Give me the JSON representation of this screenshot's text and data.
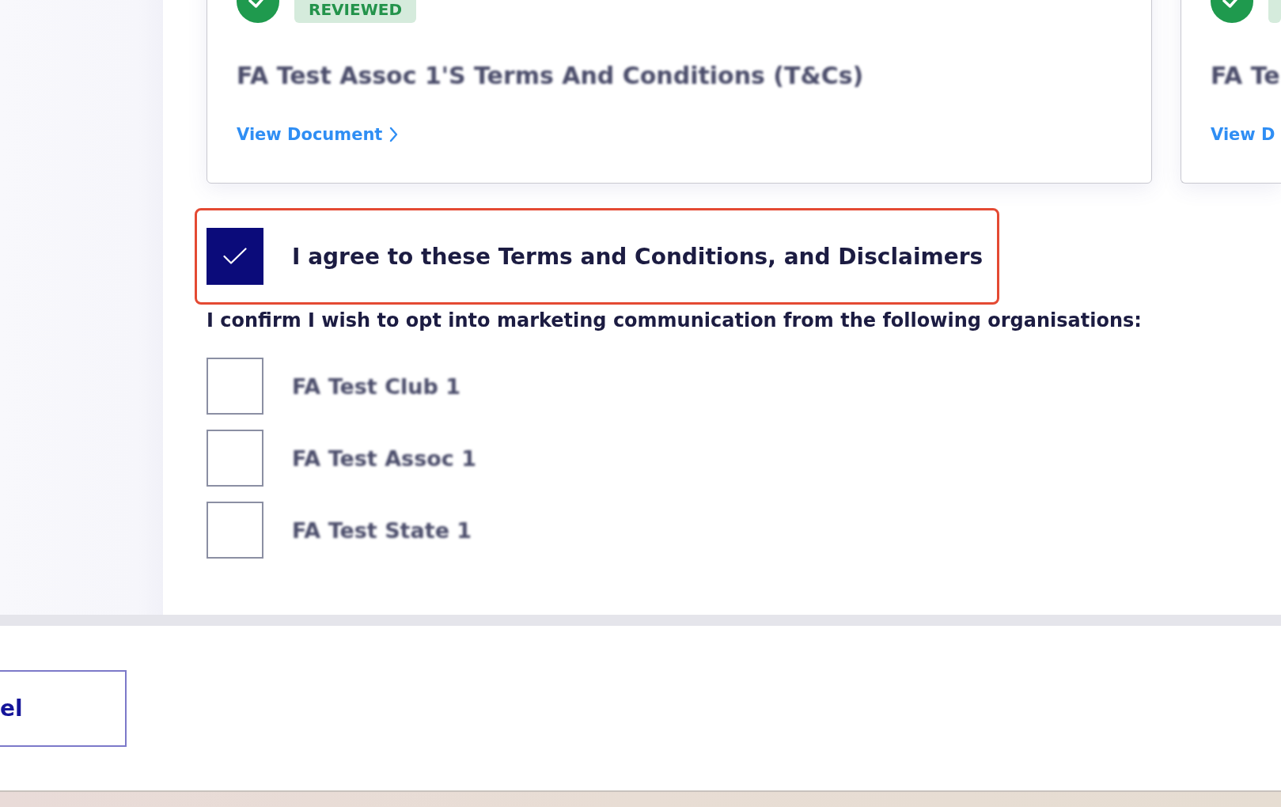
{
  "cards": [
    {
      "kind": "reviewed",
      "badge": "REVIEWED",
      "title": "FA Test Assoc 1'S Terms And Conditions (T&Cs)",
      "redacted": true,
      "link": {
        "text": "View Document",
        "chevron": true
      }
    },
    {
      "kind": "reviewed",
      "title": "FA Te",
      "redacted": true,
      "link": {
        "text": "View D"
      }
    }
  ],
  "agreement": {
    "label": "I agree to these Terms and Conditions, and Disclaimers",
    "checked": true,
    "highlighted": true
  },
  "marketing": {
    "prompt": "I confirm I wish to opt into marketing communication from the following organisations:",
    "organisations": [
      {
        "name": "FA Test Club 1",
        "checked": false,
        "redacted": true
      },
      {
        "name": "FA Test Assoc 1",
        "checked": false,
        "redacted": true
      },
      {
        "name": "FA Test State 1",
        "checked": false,
        "redacted": true
      }
    ]
  },
  "footer": {
    "buttons": [
      {
        "kind": "secondary",
        "label": "el"
      }
    ]
  }
}
